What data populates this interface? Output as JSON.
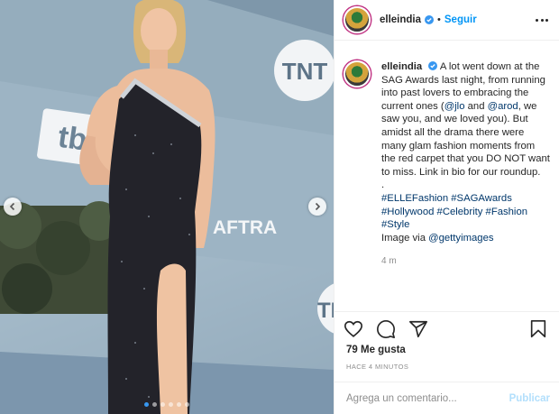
{
  "post": {
    "username": "elleindia",
    "follow_label": "Seguir",
    "header_separator": "•",
    "caption": {
      "username": "elleindia",
      "line1_a": "A lot went down at the SAG Awards last night, from running into past lovers to embracing the current ones (",
      "mention_jlo": "@jlo",
      "line1_and": " and ",
      "mention_arod": "@arod",
      "line1_b": ", we saw you, and we loved you). But amidst all the drama there were many glam fashion moments from the red carpet that you DO NOT want to miss. Link in bio for our roundup.",
      "dot_line": ".",
      "hashtags_1": "#ELLEFashion #SAGAwards",
      "hashtags_2": "#Hollywood #Celebrity #Fashion",
      "hashtags_3": "#Style",
      "credit_prefix": "Image via ",
      "credit_handle": "@gettyimages",
      "age": "4 m"
    },
    "likes": "79 Me gusta",
    "posted_time": "HACE 4 MINUTOS",
    "comment_placeholder": "Agrega un comentario...",
    "publish_label": "Publicar"
  },
  "photo": {
    "backdrop_text_1": "TNT",
    "backdrop_text_2": "tbs",
    "backdrop_text_3": "AFTRA",
    "backdrop_text_4": "TN",
    "carousel_dots": 6,
    "active_dot": 0
  },
  "colors": {
    "accent": "#0095f6",
    "publish_disabled": "#b2dffc",
    "carousel_active": "#3897f0"
  },
  "icons": [
    "heart-icon",
    "comment-icon",
    "share-icon",
    "bookmark-icon",
    "verified-icon",
    "more-options-icon",
    "chevron-left-icon",
    "chevron-right-icon"
  ]
}
